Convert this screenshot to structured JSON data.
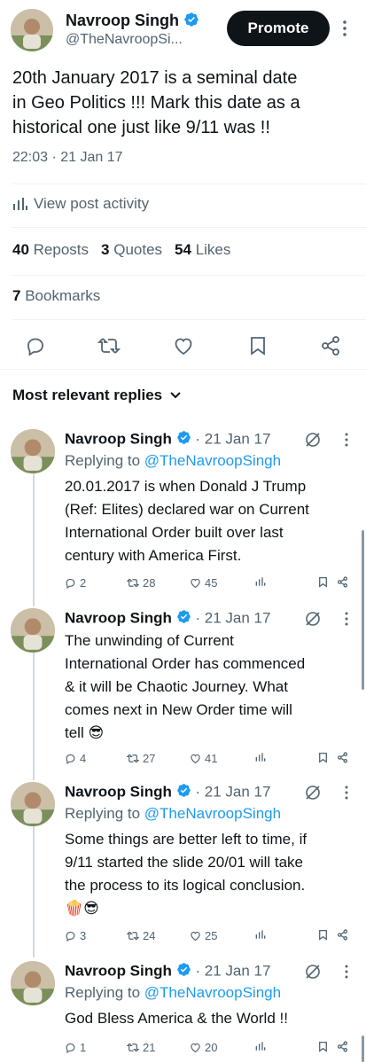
{
  "author": {
    "name": "Navroop Singh",
    "handle": "@TheNavroopSi..."
  },
  "promote_label": "Promote",
  "tweet": {
    "text_lines": [
      "20th January 2017 is a seminal date",
      "in Geo Politics !!! Mark this date as a",
      "historical one just like 9/11 was !!"
    ],
    "timestamp": "22:03 · 21 Jan 17"
  },
  "activity_label": "View post activity",
  "stats": {
    "reposts_num": "40",
    "reposts_label": "Reposts",
    "quotes_num": "3",
    "quotes_label": "Quotes",
    "likes_num": "54",
    "likes_label": "Likes",
    "bookmarks_num": "7",
    "bookmarks_label": "Bookmarks"
  },
  "replies_header": "Most relevant replies",
  "replies": [
    {
      "name": "Navroop Singh",
      "date": "· 21 Jan 17",
      "replying_prefix": "Replying to ",
      "replying_handle": "@TheNavroopSingh",
      "lines": [
        "20.01.2017 is when Donald J Trump",
        "(Ref: Elites) declared war on Current",
        "International Order built over last",
        "century with America First."
      ],
      "replies": "2",
      "reposts": "28",
      "likes": "45"
    },
    {
      "name": "Navroop Singh",
      "date": "· 21 Jan 17",
      "lines": [
        "The unwinding of Current",
        "International Order has commenced",
        "& it will be Chaotic Journey. What",
        "comes next in New Order time will",
        "tell 😎"
      ],
      "replies": "4",
      "reposts": "27",
      "likes": "41"
    },
    {
      "name": "Navroop Singh",
      "date": "· 21 Jan 17",
      "replying_prefix": "Replying to ",
      "replying_handle": "@TheNavroopSingh",
      "lines": [
        "Some things are better left to time, if",
        "9/11 started the slide 20/01 will take",
        "the process to its logical conclusion.",
        "🍿😎"
      ],
      "replies": "3",
      "reposts": "24",
      "likes": "25"
    },
    {
      "name": "Navroop Singh",
      "date": "· 21 Jan 17",
      "replying_prefix": "Replying to ",
      "replying_handle": "@TheNavroopSingh",
      "lines": [
        "God Bless America & the World !!"
      ],
      "replies": "1",
      "reposts": "21",
      "likes": "20"
    }
  ],
  "colors": {
    "accent": "#1d9bf0",
    "text": "#0f1419",
    "muted": "#536471",
    "divider": "#eff3f4"
  },
  "icons": [
    "verified-badge-icon",
    "more-icon",
    "bar-chart-icon",
    "reply-icon",
    "repost-icon",
    "like-icon",
    "bookmark-icon",
    "share-icon",
    "chevron-down-icon",
    "grok-icon"
  ]
}
